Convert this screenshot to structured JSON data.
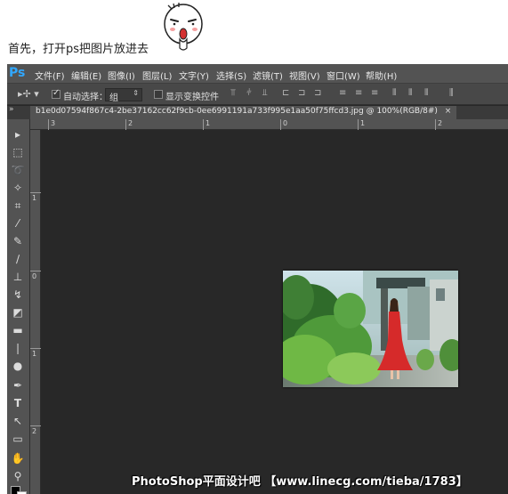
{
  "intro": {
    "text": "首先，打开ps把图片放进去"
  },
  "app": {
    "logo": "Ps",
    "menu": [
      "文件(F)",
      "编辑(E)",
      "图像(I)",
      "图层(L)",
      "文字(Y)",
      "选择(S)",
      "滤镜(T)",
      "视图(V)",
      "窗口(W)",
      "帮助(H)"
    ]
  },
  "options": {
    "auto_select_label": "自动选择：",
    "auto_select_checked": true,
    "group_value": "组",
    "show_transform_label": "显示变换控件",
    "show_transform_checked": false
  },
  "document": {
    "tab_title": "b1e0d07594f867c4-2be37162cc62f9cb-0ee6991191a733f995e1aa50f75ffcd3.jpg @ 100%(RGB/8#)",
    "close_glyph": "×"
  },
  "rulers": {
    "horizontal": [
      "3",
      "2",
      "1",
      "0",
      "1",
      "2"
    ],
    "vertical": [
      "1",
      "0",
      "1",
      "2"
    ]
  },
  "watermark": "PhotoShop平面设计吧  【www.linecg.com/tieba/1783】",
  "colors": {
    "menubar": "#535353",
    "canvas": "#282828",
    "ps_blue": "#31a8ff"
  }
}
